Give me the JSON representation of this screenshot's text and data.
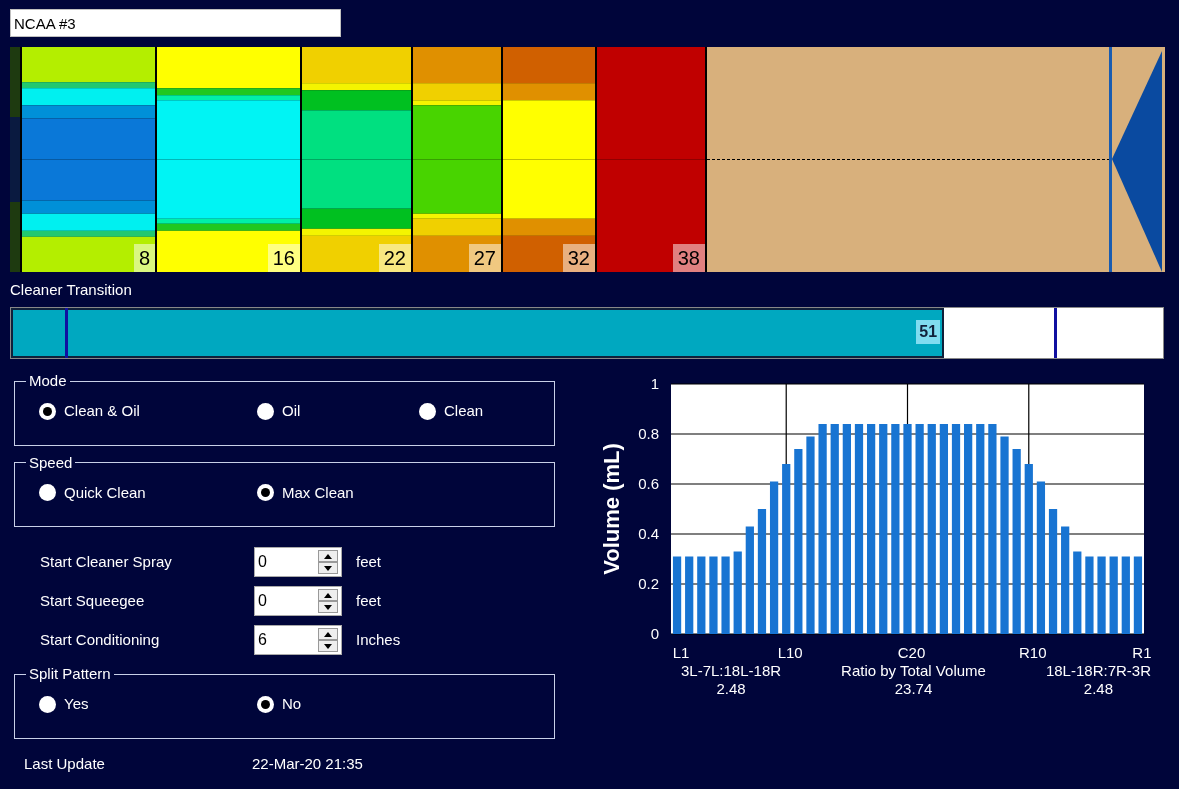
{
  "pattern_name": {
    "value": "NCAA #3"
  },
  "lane": {
    "segments": [
      {
        "label": "8"
      },
      {
        "label": "16"
      },
      {
        "label": "22"
      },
      {
        "label": "27"
      },
      {
        "label": "32"
      },
      {
        "label": "38"
      }
    ]
  },
  "cleaner_transition": {
    "label": "Cleaner Transition",
    "level": 0.81,
    "reading": "51"
  },
  "mode": {
    "legend": "Mode",
    "options": [
      {
        "label": "Clean & Oil",
        "selected": true
      },
      {
        "label": "Oil",
        "selected": false
      },
      {
        "label": "Clean",
        "selected": false
      }
    ]
  },
  "speed": {
    "legend": "Speed",
    "options": [
      {
        "label": "Quick Clean",
        "selected": false
      },
      {
        "label": "Max Clean",
        "selected": true
      }
    ]
  },
  "settings": [
    {
      "label": "Start Cleaner Spray",
      "value": "0",
      "unit": "feet"
    },
    {
      "label": "Start Squeegee",
      "value": "0",
      "unit": "feet"
    },
    {
      "label": "Start Conditioning",
      "value": "6",
      "unit": "Inches"
    }
  ],
  "split_pattern": {
    "legend": "Split Pattern",
    "options": [
      {
        "label": "Yes",
        "selected": false
      },
      {
        "label": "No",
        "selected": true
      }
    ]
  },
  "last_update": {
    "label": "Last Update",
    "value": "22-Mar-20 21:35"
  },
  "chart": {
    "chart_data": {
      "type": "bar",
      "ylabel": "Volume (mL)",
      "categories": [
        "L1",
        null,
        null,
        null,
        null,
        null,
        null,
        null,
        null,
        "L10",
        null,
        null,
        null,
        null,
        null,
        null,
        null,
        null,
        null,
        "C20",
        null,
        null,
        null,
        null,
        null,
        null,
        null,
        null,
        null,
        "R10",
        null,
        null,
        null,
        null,
        null,
        null,
        null,
        null,
        "R1"
      ],
      "grid": true,
      "values": [
        0.31,
        0.31,
        0.31,
        0.31,
        0.31,
        0.33,
        0.43,
        0.5,
        0.61,
        0.68,
        0.74,
        0.79,
        0.84,
        0.84,
        0.84,
        0.84,
        0.84,
        0.84,
        0.84,
        0.84,
        0.84,
        0.84,
        0.84,
        0.84,
        0.84,
        0.84,
        0.84,
        0.79,
        0.74,
        0.68,
        0.61,
        0.5,
        0.43,
        0.33,
        0.31,
        0.31,
        0.31,
        0.31,
        0.31
      ],
      "ylim": [
        0,
        1
      ],
      "yticks": [
        0,
        0.2,
        0.4,
        0.6,
        0.8,
        1
      ]
    },
    "footer": [
      {
        "label": "3L-7L:18L-18R",
        "value": "2.48"
      },
      {
        "label": "Ratio by Total Volume",
        "value": "23.74"
      },
      {
        "label": "18L-18R:7R-3R",
        "value": "2.48"
      }
    ]
  }
}
